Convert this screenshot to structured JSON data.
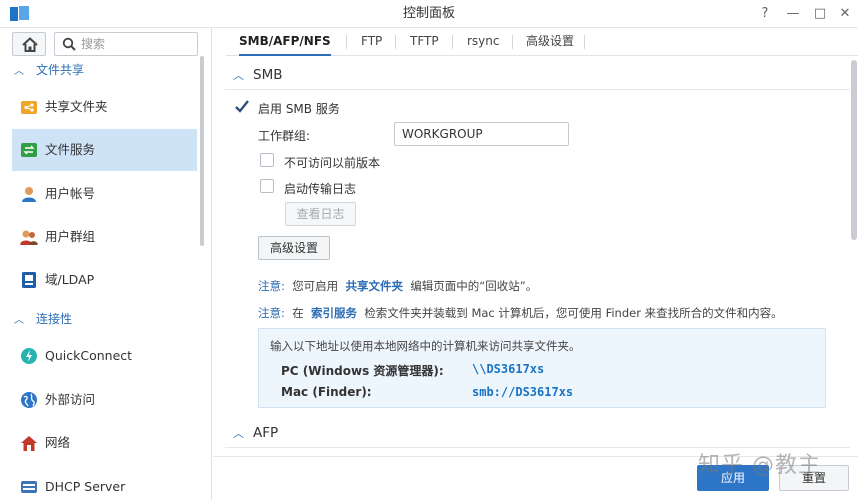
{
  "window": {
    "title": "控制面板",
    "controls": {
      "help": "?",
      "minimize": "—",
      "maximize": "□",
      "close": "✕"
    }
  },
  "sidebar": {
    "search_placeholder": "搜索",
    "sections": [
      {
        "label": "文件共享",
        "expanded": true
      },
      {
        "label": "连接性",
        "expanded": true
      }
    ],
    "items": [
      {
        "label": "共享文件夹",
        "icon": "shared-folder-icon",
        "active": false
      },
      {
        "label": "文件服务",
        "icon": "file-services-icon",
        "active": true
      },
      {
        "label": "用户帐号",
        "icon": "user-icon",
        "active": false
      },
      {
        "label": "用户群组",
        "icon": "group-icon",
        "active": false
      },
      {
        "label": "域/LDAP",
        "icon": "domain-ldap-icon",
        "active": false
      },
      {
        "label": "QuickConnect",
        "icon": "quickconnect-icon",
        "active": false
      },
      {
        "label": "外部访问",
        "icon": "globe-icon",
        "active": false
      },
      {
        "label": "网络",
        "icon": "network-home-icon",
        "active": false
      },
      {
        "label": "DHCP Server",
        "icon": "dhcp-icon",
        "active": false
      }
    ]
  },
  "tabs": [
    {
      "label": "SMB/AFP/NFS",
      "active": true
    },
    {
      "label": "FTP",
      "active": false
    },
    {
      "label": "TFTP",
      "active": false
    },
    {
      "label": "rsync",
      "active": false
    },
    {
      "label": "高级设置",
      "active": false
    }
  ],
  "smb": {
    "title": "SMB",
    "enable_label": "启用 SMB 服务",
    "enable_checked": true,
    "workgroup_label": "工作群组:",
    "workgroup_value": "WORKGROUP",
    "prev_versions_label": "不可访问以前版本",
    "prev_versions_checked": false,
    "transfer_log_label": "启动传输日志",
    "transfer_log_checked": false,
    "view_log_button": "查看日志",
    "advanced_button": "高级设置",
    "note1": {
      "prefix": "注意:",
      "text_a": "您可启用",
      "link": "共享文件夹",
      "text_b": "编辑页面中的“回收站”。"
    },
    "note2": {
      "prefix": "注意:",
      "text_a": "在",
      "link": "索引服务",
      "text_b": "检索文件夹并装载到 Mac 计算机后，您可使用 Finder 来查找所合的文件和内容。"
    },
    "info": {
      "intro": "输入以下地址以使用本地网络中的计算机来访问共享文件夹。",
      "pc_label": "PC (Windows 资源管理器):",
      "pc_value": "\\\\DS3617xs",
      "mac_label": "Mac (Finder):",
      "mac_value": "smb://DS3617xs"
    }
  },
  "afp": {
    "title": "AFP"
  },
  "footer": {
    "apply": "应用",
    "reset": "重置",
    "watermark": "知乎 @教主"
  },
  "colors": {
    "accent": "#2d6db5",
    "active_bg": "#cfe3f7",
    "info_bg": "#eef6fd",
    "apply_bg": "#2d75c6"
  }
}
